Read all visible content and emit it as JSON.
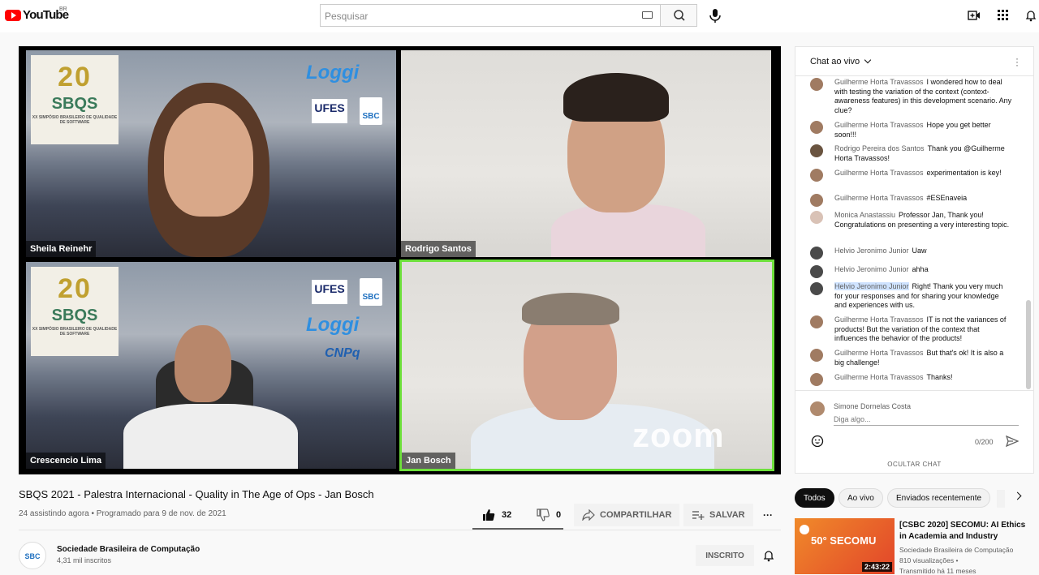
{
  "topbar": {
    "logo_text": "YouTube",
    "country_code": "BR",
    "search_placeholder": "Pesquisar",
    "icons": [
      "keyboard-icon",
      "search-icon",
      "mic-icon",
      "create-video-icon",
      "apps-icon",
      "notifications-icon"
    ]
  },
  "video": {
    "participants": [
      {
        "name": "Sheila Reinehr"
      },
      {
        "name": "Rodrigo Santos"
      },
      {
        "name": "Crescencio Lima"
      },
      {
        "name": "Jan Bosch"
      }
    ],
    "sbqs_logo": {
      "twenty": "20",
      "anos": "ANOS",
      "name": "SBQS",
      "sub": "XX SIMPÓSIO BRASILEIRO DE QUALIDADE DE SOFTWARE"
    },
    "sponsor_logos": {
      "loggi": "Loggi",
      "ufes": "UFES",
      "sbc": "SBC",
      "cnpq": "CNPq"
    },
    "zoom_watermark": "zoom",
    "active_speaker_color": "#6ee03c"
  },
  "info": {
    "title": "SBQS 2021 - Palestra Internacional - Quality in The Age of Ops - Jan Bosch",
    "meta": "24 assistindo agora • Programado para 9 de nov. de 2021",
    "likes": "32",
    "dislikes": "0",
    "share_label": "COMPARTILHAR",
    "save_label": "SALVAR",
    "more_label": "···"
  },
  "channel": {
    "avatar_text": "SBC",
    "name": "Sociedade Brasileira de Computação",
    "subs": "4,31 mil inscritos",
    "subscribe_label": "INSCRITO"
  },
  "chat": {
    "title": "Chat ao vivo",
    "messages": [
      {
        "author": "Guilherme Horta Travassos",
        "text": "I wondered how to deal with testing the variation of the context (context-awareness features) in this development scenario. Any clue?"
      },
      {
        "author": "Guilherme Horta Travassos",
        "text": "Hope you get better soon!!!"
      },
      {
        "author": "Rodrigo Pereira dos Santos",
        "text": "Thank you @Guilherme Horta Travassos!"
      },
      {
        "author": "Guilherme Horta Travassos",
        "text": "experimentation is key!"
      },
      {
        "author": "Guilherme Horta Travassos",
        "text": "#ESEnaveia"
      },
      {
        "author": "Monica Anastassiu",
        "text": "Professor Jan, Thank you! Congratulations on presenting a very interesting topic."
      },
      {
        "author": "Helvio Jeronimo Junior",
        "text": "Uaw"
      },
      {
        "author": "Helvio Jeronimo Junior",
        "text": "ahha"
      },
      {
        "author": "Helvio Jeronimo Junior",
        "text": "Right! Thank you very much for your responses and for sharing your knowledge and experiences with us."
      },
      {
        "author": "Guilherme Horta Travassos",
        "text": "IT is not the variances of products! But the variation of the context that influences the behavior of the products!"
      },
      {
        "author": "Guilherme Horta Travassos",
        "text": "But that's ok! It is also a big challenge!"
      },
      {
        "author": "Guilherme Horta Travassos",
        "text": "Thanks!"
      }
    ],
    "current_user": "Simone Dornelas Costa",
    "input_placeholder": "Diga algo...",
    "counter": "0/200",
    "hide_label": "OCULTAR CHAT"
  },
  "chips": [
    "Todos",
    "Ao vivo",
    "Enviados recentemente"
  ],
  "recommendation": {
    "thumb_title": "50° SECOMU",
    "duration": "2:43:22",
    "title": "[CSBC 2020] SECOMU: AI Ethics in Academia and Industry",
    "channel": "Sociedade Brasileira de Computação",
    "views": "810 visualizações •",
    "age": "Transmitido há 11 meses"
  }
}
